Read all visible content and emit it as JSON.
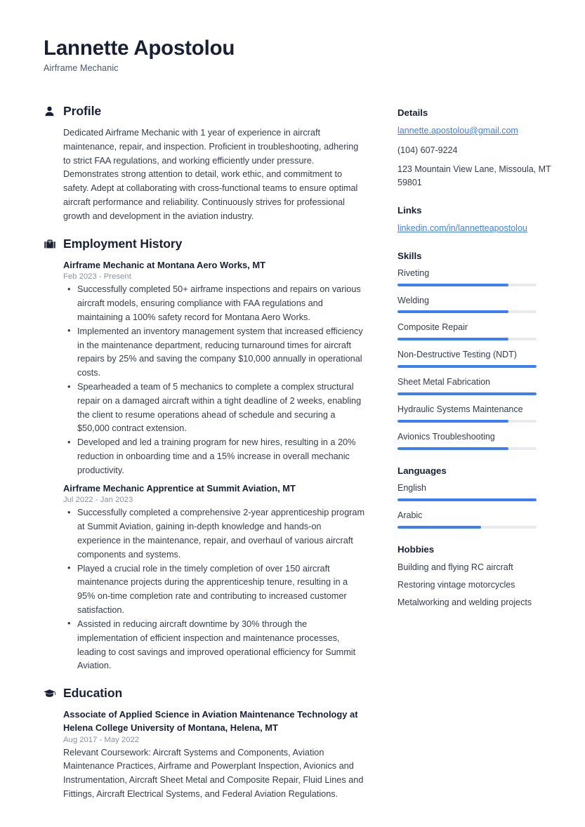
{
  "header": {
    "full_name": "Lannette Apostolou",
    "job_title": "Airframe Mechanic"
  },
  "theme": {
    "accent": "#3d7df5",
    "heading": "#1a2034",
    "text": "#343b4a",
    "muted": "#8b92a0",
    "track": "#e8eaed"
  },
  "sections": {
    "profile": {
      "title": "Profile",
      "icon": "person-icon",
      "text": "Dedicated Airframe Mechanic with 1 year of experience in aircraft maintenance, repair, and inspection. Proficient in troubleshooting, adhering to strict FAA regulations, and working efficiently under pressure. Demonstrates strong attention to detail, work ethic, and commitment to safety. Adept at collaborating with cross-functional teams to ensure optimal aircraft performance and reliability. Continuously strives for professional growth and development in the aviation industry."
    },
    "employment": {
      "title": "Employment History",
      "icon": "briefcase-icon",
      "entries": [
        {
          "title": "Airframe Mechanic at Montana Aero Works, MT",
          "date": "Feb 2023 - Present",
          "bullets": [
            "Successfully completed 50+ airframe inspections and repairs on various aircraft models, ensuring compliance with FAA regulations and maintaining a 100% safety record for Montana Aero Works.",
            "Implemented an inventory management system that increased efficiency in the maintenance department, reducing turnaround times for aircraft repairs by 25% and saving the company $10,000 annually in operational costs.",
            "Spearheaded a team of 5 mechanics to complete a complex structural repair on a damaged aircraft within a tight deadline of 2 weeks, enabling the client to resume operations ahead of schedule and securing a $50,000 contract extension.",
            "Developed and led a training program for new hires, resulting in a 20% reduction in onboarding time and a 15% increase in overall mechanic productivity."
          ]
        },
        {
          "title": "Airframe Mechanic Apprentice at Summit Aviation, MT",
          "date": "Jul 2022 - Jan 2023",
          "bullets": [
            "Successfully completed a comprehensive 2-year apprenticeship program at Summit Aviation, gaining in-depth knowledge and hands-on experience in the maintenance, repair, and overhaul of various aircraft components and systems.",
            "Played a crucial role in the timely completion of over 150 aircraft maintenance projects during the apprenticeship tenure, resulting in a 95% on-time completion rate and contributing to increased customer satisfaction.",
            "Assisted in reducing aircraft downtime by 30% through the implementation of efficient inspection and maintenance processes, leading to cost savings and improved operational efficiency for Summit Aviation."
          ]
        }
      ]
    },
    "education": {
      "title": "Education",
      "icon": "graduation-cap-icon",
      "entries": [
        {
          "title": "Associate of Applied Science in Aviation Maintenance Technology at Helena College University of Montana, Helena, MT",
          "date": "Aug 2017 - May 2022",
          "description": "Relevant Coursework: Aircraft Systems and Components, Aviation Maintenance Practices, Airframe and Powerplant Inspection, Avionics and Instrumentation, Aircraft Sheet Metal and Composite Repair, Fluid Lines and Fittings, Aircraft Electrical Systems, and Federal Aviation Regulations."
        }
      ]
    }
  },
  "sidebar": {
    "details": {
      "title": "Details",
      "email": "lannette.apostolou@gmail.com",
      "phone": "(104) 607-9224",
      "address": "123 Mountain View Lane, Missoula, MT 59801"
    },
    "links": {
      "title": "Links",
      "items": [
        {
          "label": "linkedin.com/in/lannetteapostolou"
        }
      ]
    },
    "skills": {
      "title": "Skills",
      "items": [
        {
          "label": "Riveting",
          "level": 80
        },
        {
          "label": "Welding",
          "level": 80
        },
        {
          "label": "Composite Repair",
          "level": 80
        },
        {
          "label": "Non-Destructive Testing (NDT)",
          "level": 100
        },
        {
          "label": "Sheet Metal Fabrication",
          "level": 100
        },
        {
          "label": "Hydraulic Systems Maintenance",
          "level": 80
        },
        {
          "label": "Avionics Troubleshooting",
          "level": 80
        }
      ]
    },
    "languages": {
      "title": "Languages",
      "items": [
        {
          "label": "English",
          "level": 100
        },
        {
          "label": "Arabic",
          "level": 60
        }
      ]
    },
    "hobbies": {
      "title": "Hobbies",
      "items": [
        {
          "label": "Building and flying RC aircraft"
        },
        {
          "label": "Restoring vintage motorcycles"
        },
        {
          "label": "Metalworking and welding projects"
        }
      ]
    }
  }
}
